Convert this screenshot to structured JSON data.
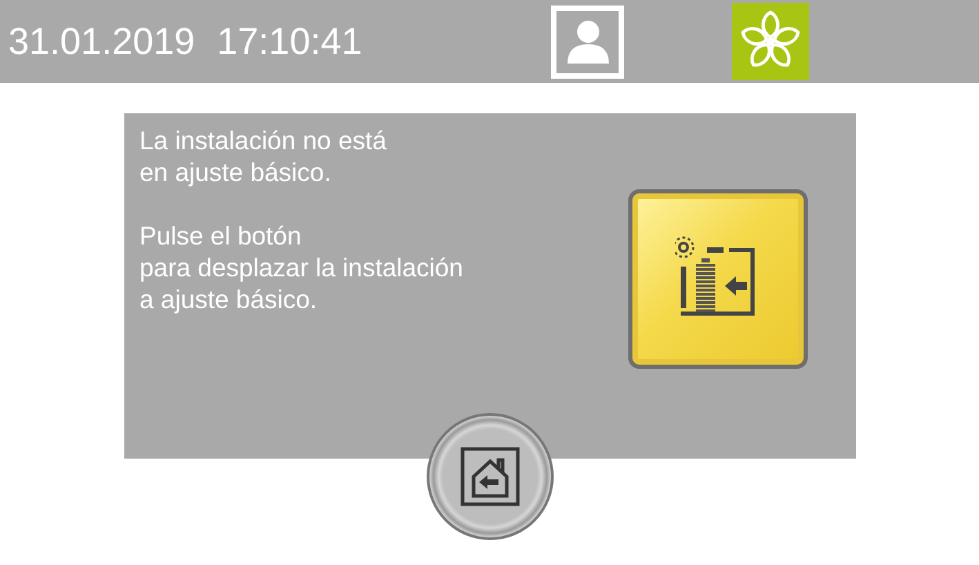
{
  "status_bar": {
    "date": "31.01.2019",
    "time": "17:10:41"
  },
  "message": {
    "paragraphs": [
      {
        "lines": [
          "La instalación no está",
          "en ajuste básico."
        ]
      },
      {
        "lines": [
          "Pulse el botón",
          "para desplazar la instalación",
          "a ajuste básico."
        ]
      }
    ]
  }
}
